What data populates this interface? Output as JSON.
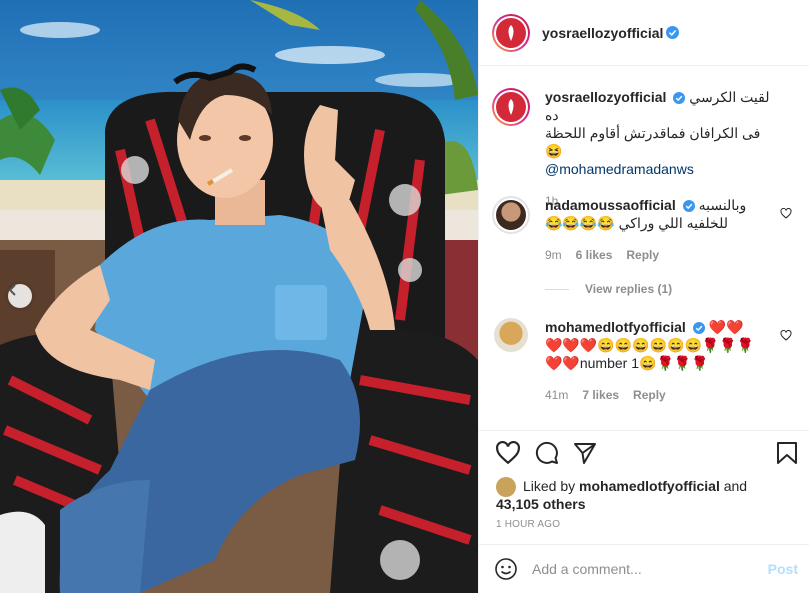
{
  "post": {
    "username": "yosraellozyofficial"
  },
  "caption": {
    "username": "yosraellozyofficial",
    "text_line1": "لقيت الكرسي ده",
    "text_line2": "فى الكرافان فماقدرتش أقاوم اللحظة 😆",
    "mention": "@mohamedramadanws",
    "time": "1h"
  },
  "comments": [
    {
      "username": "nadamoussaofficial",
      "text_line1": "وبالنسبه",
      "text_line2": "للخلفيه اللي وراكي 😂😂😂😂",
      "time": "9m",
      "likes": "6 likes",
      "reply": "Reply",
      "view_replies": "View replies (1)"
    },
    {
      "username": "mohamedlotfyofficial",
      "text_line1": "❤️❤️",
      "text_line2": "❤️❤️❤️😄😄😄😄😄😄🌹🌹🌹",
      "text_line3": "❤️❤️number 1😄🌹🌹🌹",
      "time": "41m",
      "likes": "7 likes",
      "reply": "Reply"
    }
  ],
  "likes": {
    "prefix": "Liked by",
    "user": "mohamedlotfyofficial",
    "and": "and",
    "others": "43,105 others"
  },
  "timestamp": "1 HOUR AGO",
  "composer": {
    "placeholder": "Add a comment...",
    "post_label": "Post"
  },
  "colors": {
    "verified": "#3897f0",
    "avatar_red": "#d32a3a",
    "post_disabled": "#b2dffc",
    "meta_gray": "#8e8e8e"
  },
  "icons": [
    "chevron-left-icon",
    "verified-badge-icon",
    "heart-icon",
    "comment-icon",
    "share-icon",
    "bookmark-icon",
    "emoji-icon"
  ]
}
